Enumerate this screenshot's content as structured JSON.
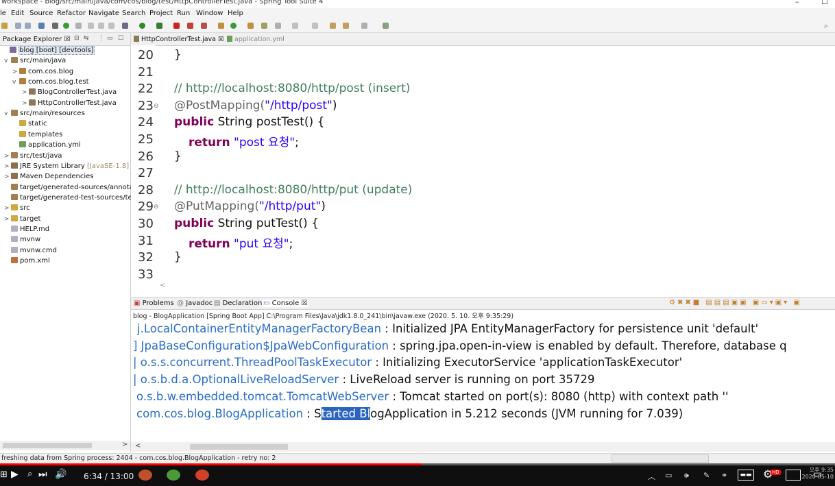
{
  "window": {
    "title": "workspace - blog/src/main/java/com/cos/blog/test/HttpControllerTest.java - Spring Tool Suite 4",
    "minimize": "–",
    "maximize": "☐"
  },
  "menu": [
    "le",
    "Edit",
    "Source",
    "Refactor",
    "Navigate",
    "Search",
    "Project",
    "Run",
    "Window",
    "Help"
  ],
  "package_explorer": {
    "tab_label": "Package Explorer",
    "tab_close": "☒",
    "items": [
      {
        "label": "blog [boot] [devtools]",
        "icon": "project-icon",
        "selected": true
      },
      {
        "label": "src/main/java",
        "icon": "source-folder-icon",
        "twisty": "v"
      },
      {
        "label": "com.cos.blog",
        "icon": "package-icon",
        "twisty": ">"
      },
      {
        "label": "com.cos.blog.test",
        "icon": "package-icon",
        "twisty": "v"
      },
      {
        "label": "BlogControllerTest.java",
        "icon": "java-file-icon",
        "twisty": ">"
      },
      {
        "label": "HttpControllerTest.java",
        "icon": "java-file-icon",
        "twisty": ">"
      },
      {
        "label": "src/main/resources",
        "icon": "source-folder-icon",
        "twisty": "v"
      },
      {
        "label": "static",
        "icon": "folder-icon"
      },
      {
        "label": "templates",
        "icon": "folder-icon"
      },
      {
        "label": "application.yml",
        "icon": "yml-file-icon"
      },
      {
        "label": "src/test/java",
        "icon": "source-folder-icon",
        "twisty": ">"
      },
      {
        "label": "JRE System Library",
        "extra": "[JavaSE-1.8]",
        "icon": "library-icon",
        "twisty": ">"
      },
      {
        "label": "Maven Dependencies",
        "icon": "library-icon",
        "twisty": ">"
      },
      {
        "label": "target/generated-sources/annotati",
        "icon": "source-folder-icon"
      },
      {
        "label": "target/generated-test-sources/test",
        "icon": "source-folder-icon"
      },
      {
        "label": "src",
        "icon": "folder-icon",
        "twisty": ">"
      },
      {
        "label": "target",
        "icon": "folder-icon",
        "twisty": ">"
      },
      {
        "label": "HELP.md",
        "icon": "text-file-icon"
      },
      {
        "label": "mvnw",
        "icon": "text-file-icon"
      },
      {
        "label": "mvnw.cmd",
        "icon": "text-file-icon"
      },
      {
        "label": "pom.xml",
        "icon": "xml-file-icon"
      }
    ]
  },
  "editor": {
    "tabs": [
      {
        "label": "HttpControllerTest.java ☒",
        "active": true
      },
      {
        "label": "application.yml",
        "active": false
      }
    ],
    "lines": [
      {
        "num": "20",
        "fold": "",
        "text": "}",
        "kind": "plain"
      },
      {
        "num": "21",
        "fold": "",
        "text": "",
        "kind": "plain"
      },
      {
        "num": "22",
        "fold": "",
        "text": "// http://localhost:8080/http/post (insert)",
        "kind": "comment"
      },
      {
        "num": "23",
        "fold": "⊖",
        "a": "@PostMapping(",
        "b": "\"/http/post\"",
        "c": ")",
        "kind": "annotation"
      },
      {
        "num": "24",
        "fold": "",
        "a": "public",
        "b": " String postTest() {",
        "kind": "method"
      },
      {
        "num": "25",
        "fold": "",
        "a": "return",
        "b": " \"post 요청\"",
        "c": ";",
        "kind": "return"
      },
      {
        "num": "26",
        "fold": "",
        "text": "}",
        "kind": "plain"
      },
      {
        "num": "27",
        "fold": "",
        "text": "",
        "kind": "plain"
      },
      {
        "num": "28",
        "fold": "",
        "text": "// http://localhost:8080/http/put (update)",
        "kind": "comment"
      },
      {
        "num": "29",
        "fold": "⊖",
        "a": "@PutMapping(",
        "b": "\"/http/put\"",
        "c": ")",
        "kind": "annotation"
      },
      {
        "num": "30",
        "fold": "",
        "a": "public",
        "b": " String putTest() {",
        "kind": "method"
      },
      {
        "num": "31",
        "fold": "",
        "a": "return",
        "b": " \"put 요청\"",
        "c": ";",
        "kind": "return"
      },
      {
        "num": "32",
        "fold": "",
        "text": "}",
        "kind": "plain"
      },
      {
        "num": "33",
        "fold": "",
        "text": "",
        "kind": "plain"
      }
    ],
    "scroll_left": "<"
  },
  "console": {
    "tabs": [
      "Problems",
      "Javadoc",
      "Declaration",
      "Console ☒"
    ],
    "info": "blog - BlogApplication [Spring Boot App] C:\\Program Files\\Java\\jdk1.8.0_241\\bin\\javaw.exe  (2020. 5. 10. 오후 9:35:29)",
    "rows": [
      {
        "src": "j.LocalContainerEntityManagerFactoryBean",
        "msg": " : Initialized JPA EntityManagerFactory for persistence unit 'default'"
      },
      {
        "src": "] JpaBaseConfiguration$JpaWebConfiguration",
        "msg": " : spring.jpa.open-in-view is enabled by default. Therefore, database q"
      },
      {
        "src": "| o.s.s.concurrent.ThreadPoolTaskExecutor",
        "msg": "  : Initializing ExecutorService 'applicationTaskExecutor'"
      },
      {
        "src": "| o.s.b.d.a.OptionalLiveReloadServer",
        "msg": "       : LiveReload server is running on port 35729"
      },
      {
        "src": "o.s.b.w.embedded.tomcat.TomcatWebServer",
        "msg": "  : Tomcat started on port(s): 8080 (http) with context path ''"
      },
      {
        "src": "com.cos.blog.BlogApplication",
        "msg_pre": "                 : S",
        "msg_hl": "tarted Bl",
        "msg_post": "ogApplication in 5.212 seconds (JVM running for 7.039)"
      }
    ],
    "scroll_left": "<",
    "pkg_scroll_right": ">"
  },
  "status": {
    "text": "freshing data from Spring process: 2404 - com.cos.blog.BlogApplication - retry no: 2"
  },
  "video": {
    "time": "6:34 / 13:00",
    "progress": 0.505,
    "clock_time": "오후 9:35",
    "clock_date": "2020-05-10",
    "hd_badge": "HD"
  },
  "colors": {
    "youtube_red": "#ff0000",
    "console_source": "#2a6cc8",
    "keyword": "#7f0055",
    "string": "#2a00ff",
    "comment": "#3f7f5f"
  }
}
